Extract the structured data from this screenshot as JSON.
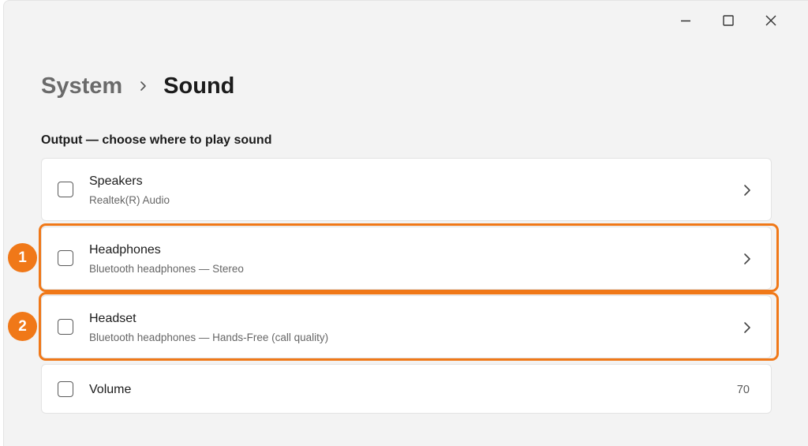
{
  "window": {
    "controls": {
      "minimize_icon": "minimize-icon",
      "maximize_icon": "maximize-icon",
      "close_icon": "close-icon"
    }
  },
  "breadcrumb": {
    "parent": "System",
    "separator_icon": "chevron-right-icon",
    "current": "Sound"
  },
  "section": {
    "title": "Output — choose where to play sound"
  },
  "devices": [
    {
      "title": "Speakers",
      "subtitle": "Realtek(R) Audio",
      "checked": false
    },
    {
      "title": "Headphones",
      "subtitle": "Bluetooth headphones — Stereo",
      "checked": false
    },
    {
      "title": "Headset",
      "subtitle": "Bluetooth headphones — Hands-Free (call quality)",
      "checked": false
    }
  ],
  "volume": {
    "label": "Volume",
    "value": "70",
    "checked": false
  },
  "annotations": [
    {
      "number": "1",
      "target": "Headphones"
    },
    {
      "number": "2",
      "target": "Headset"
    }
  ],
  "colors": {
    "accent_orange": "#f07818",
    "window_bg": "#f3f3f3",
    "card_bg": "#ffffff",
    "text_primary": "#1b1b1b",
    "text_secondary": "#666666"
  }
}
